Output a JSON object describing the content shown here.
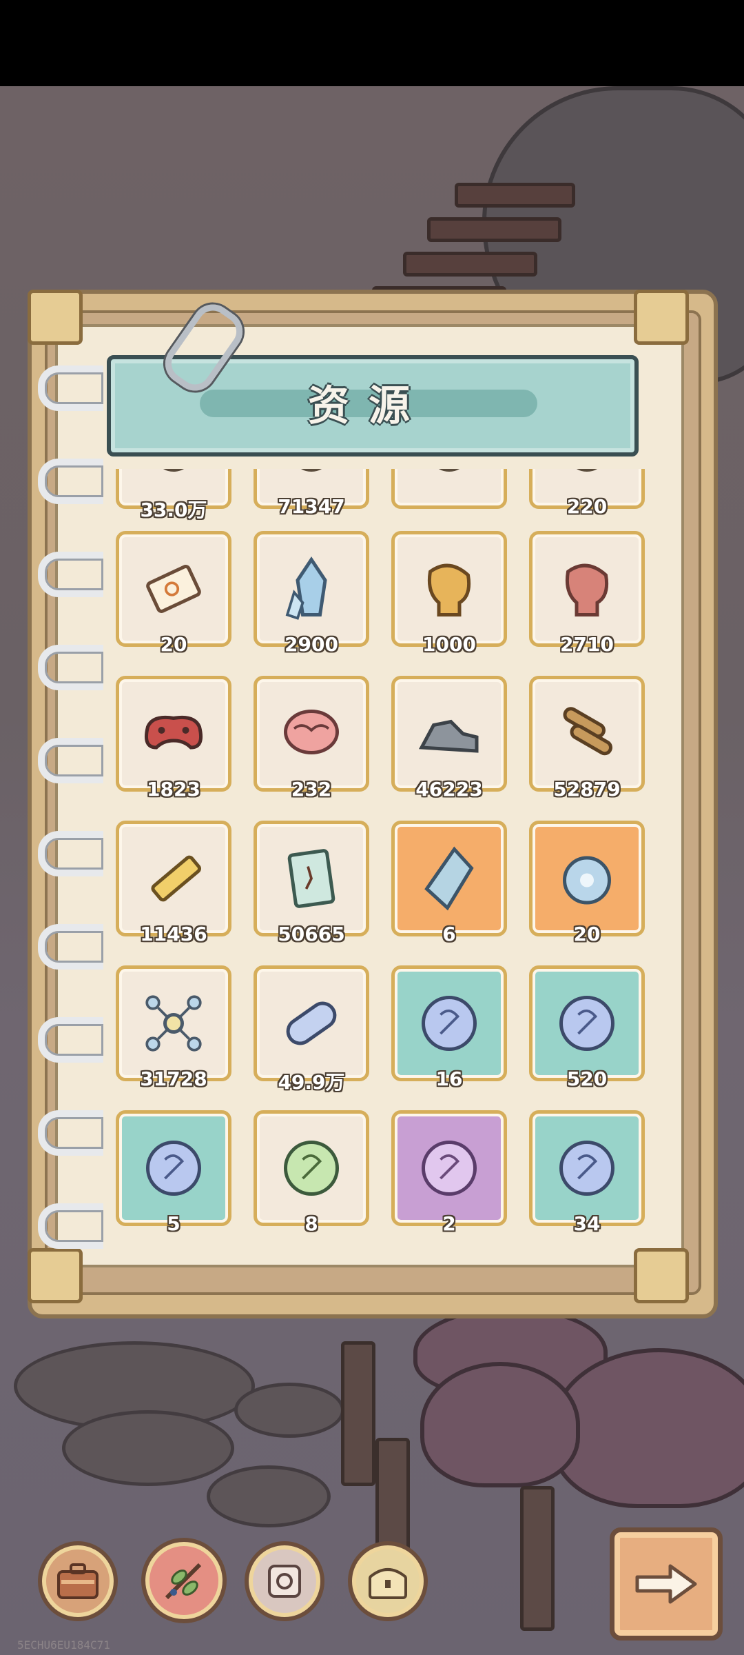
{
  "window": {
    "title": "资源"
  },
  "resources": [
    {
      "count": "33.0万",
      "icon": "partial-item-icon",
      "bg": "#f3e9dc"
    },
    {
      "count": "71347",
      "icon": "partial-item-icon",
      "bg": "#f3e9dc"
    },
    {
      "count": "",
      "icon": "partial-item-icon",
      "bg": "#f3e9dc"
    },
    {
      "count": "220",
      "icon": "partial-item-icon",
      "bg": "#f3e9dc"
    },
    {
      "count": "20",
      "icon": "ticket-icon",
      "bg": "#f3e9dc"
    },
    {
      "count": "2900",
      "icon": "crystal-icon",
      "bg": "#f3e9dc"
    },
    {
      "count": "1000",
      "icon": "gold-boxing-glove-icon",
      "bg": "#f3e9dc"
    },
    {
      "count": "2710",
      "icon": "red-boxing-glove-icon",
      "bg": "#f3e9dc"
    },
    {
      "count": "1823",
      "icon": "gamepad-icon",
      "bg": "#f3e9dc"
    },
    {
      "count": "232",
      "icon": "brain-icon",
      "bg": "#f3e9dc"
    },
    {
      "count": "46223",
      "icon": "stone-icon",
      "bg": "#f3e9dc"
    },
    {
      "count": "52879",
      "icon": "wood-logs-icon",
      "bg": "#f3e9dc"
    },
    {
      "count": "11436",
      "icon": "glue-tube-icon",
      "bg": "#f3e9dc"
    },
    {
      "count": "50665",
      "icon": "blueprint-scroll-icon",
      "bg": "#f3e9dc"
    },
    {
      "count": "6",
      "icon": "rare-crystal-icon",
      "bg": "#f5ad6a"
    },
    {
      "count": "20",
      "icon": "orb-core-icon",
      "bg": "#f5ad6a"
    },
    {
      "count": "31728",
      "icon": "molecule-icon",
      "bg": "#f3e9dc"
    },
    {
      "count": "49.9万",
      "icon": "runic-capsule-icon",
      "bg": "#f3e9dc"
    },
    {
      "count": "16",
      "icon": "blue-rune-orb-icon",
      "bg": "#98d3c9"
    },
    {
      "count": "520",
      "icon": "blue-rune-orb-icon",
      "bg": "#98d3c9"
    },
    {
      "count": "5",
      "icon": "blue-rune-orb-icon",
      "bg": "#98d3c9"
    },
    {
      "count": "8",
      "icon": "green-rune-orb-icon",
      "bg": "#f3e9dc"
    },
    {
      "count": "2",
      "icon": "purple-rune-orb-icon",
      "bg": "#c89fd3"
    },
    {
      "count": "34",
      "icon": "blue-rune-orb-icon",
      "bg": "#98d3c9"
    }
  ],
  "bottom_nav": [
    {
      "name": "backpack-button",
      "icon": "briefcase-icon"
    },
    {
      "name": "resources-button",
      "icon": "leaf-branch-icon"
    },
    {
      "name": "parts-button",
      "icon": "puzzle-gear-icon"
    },
    {
      "name": "chest-button",
      "icon": "treasure-chest-icon"
    }
  ],
  "next_button": {
    "icon": "arrow-right-icon"
  },
  "watermark": "5ECHU6EU184C71"
}
